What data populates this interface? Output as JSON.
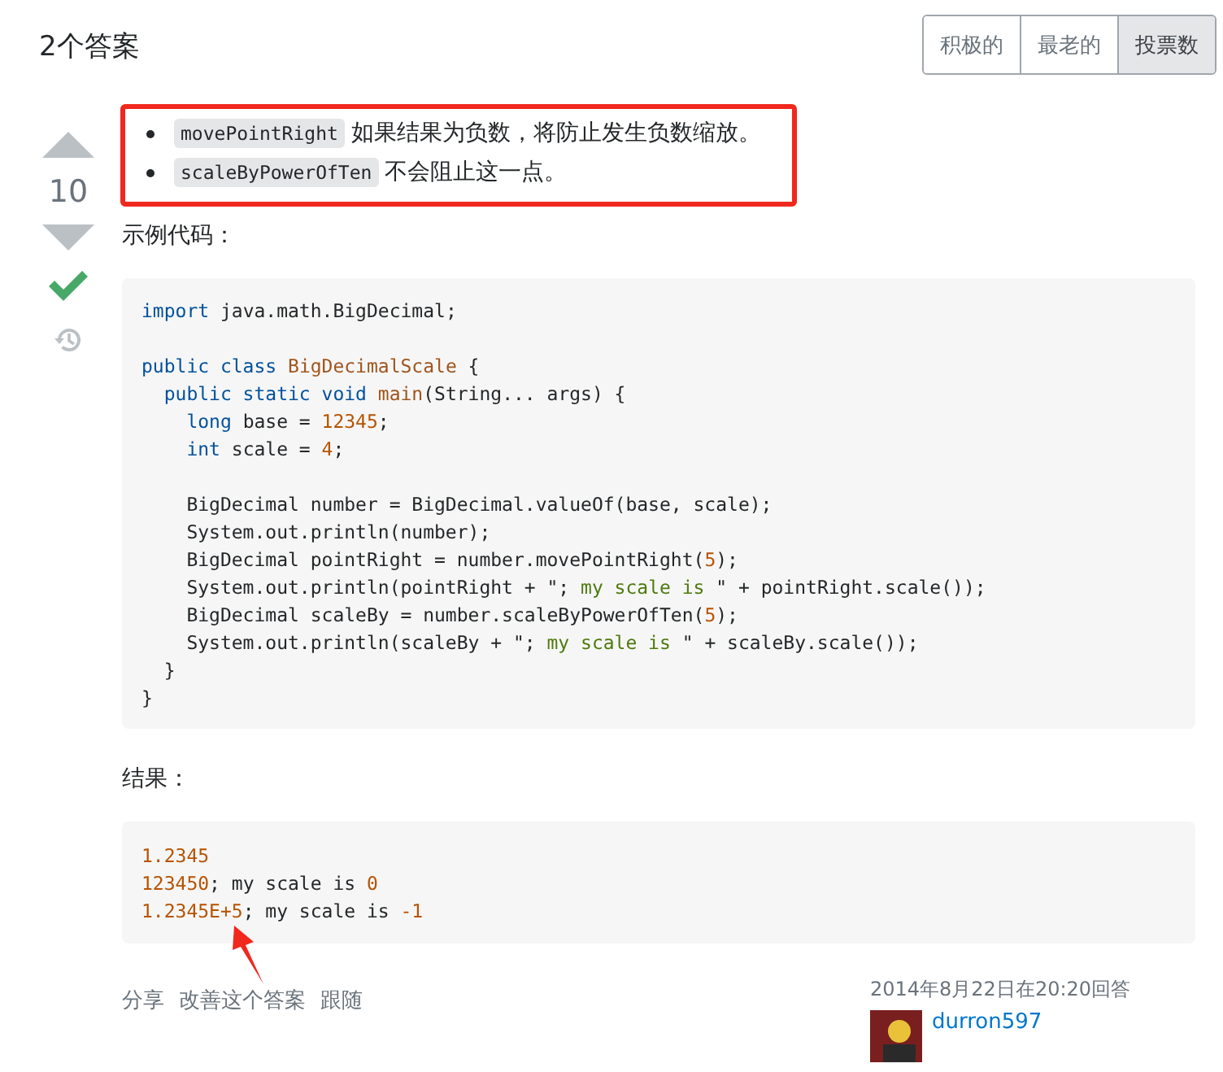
{
  "header": {
    "title": "2个答案"
  },
  "sort_tabs": [
    {
      "label": "积极的",
      "selected": false
    },
    {
      "label": "最老的",
      "selected": false
    },
    {
      "label": "投票数",
      "selected": true
    }
  ],
  "vote": {
    "score": "10",
    "accepted": true
  },
  "highlights": [
    {
      "code": "movePointRight",
      "text": "如果结果为负数，将防止发生负数缩放。"
    },
    {
      "code": "scaleByPowerOfTen",
      "text": "不会阻止这一点。"
    }
  ],
  "code_caption": "示例代码：",
  "code_lines": [
    {
      "kind": "code",
      "segments": [
        {
          "t": "import",
          "kind": "keyword"
        },
        {
          "t": " java.math.BigDecimal;",
          "kind": "plain"
        }
      ]
    },
    {
      "kind": "blank"
    },
    {
      "kind": "code",
      "segments": [
        {
          "t": "public class ",
          "kind": "keyword"
        },
        {
          "t": "BigDecimalScale",
          "kind": "title"
        },
        {
          "t": " {",
          "kind": "plain"
        }
      ]
    },
    {
      "kind": "code",
      "segments": [
        {
          "t": "  public static void ",
          "kind": "keyword"
        },
        {
          "t": "main",
          "kind": "title"
        },
        {
          "t": "(String... args) {",
          "kind": "plain"
        }
      ]
    },
    {
      "kind": "code",
      "segments": [
        {
          "t": "    long",
          "kind": "keyword"
        },
        {
          "t": " base = ",
          "kind": "plain"
        },
        {
          "t": "12345",
          "kind": "number"
        },
        {
          "t": ";",
          "kind": "plain"
        }
      ]
    },
    {
      "kind": "code",
      "segments": [
        {
          "t": "    int",
          "kind": "keyword"
        },
        {
          "t": " scale = ",
          "kind": "plain"
        },
        {
          "t": "4",
          "kind": "number"
        },
        {
          "t": ";",
          "kind": "plain"
        }
      ]
    },
    {
      "kind": "blank"
    },
    {
      "kind": "code",
      "segments": [
        {
          "t": "    BigDecimal number = BigDecimal.valueOf(base, scale);",
          "kind": "plain"
        }
      ]
    },
    {
      "kind": "code",
      "segments": [
        {
          "t": "    System.out.println(number);",
          "kind": "plain"
        }
      ]
    },
    {
      "kind": "code",
      "segments": [
        {
          "t": "    BigDecimal pointRight = number.movePointRight(",
          "kind": "plain"
        },
        {
          "t": "5",
          "kind": "number"
        },
        {
          "t": ");",
          "kind": "plain"
        }
      ]
    },
    {
      "kind": "code",
      "segments": [
        {
          "t": "    System.out.println(pointRight + \"; ",
          "kind": "plain"
        },
        {
          "t": "my scale is",
          "kind": "string"
        },
        {
          "t": " \" + pointRight.scale());",
          "kind": "plain"
        }
      ]
    },
    {
      "kind": "code",
      "segments": [
        {
          "t": "    BigDecimal scaleBy = number.scaleByPowerOfTen(",
          "kind": "plain"
        },
        {
          "t": "5",
          "kind": "number"
        },
        {
          "t": ");",
          "kind": "plain"
        }
      ]
    },
    {
      "kind": "code",
      "segments": [
        {
          "t": "    System.out.println(scaleBy + \"; ",
          "kind": "plain"
        },
        {
          "t": "my scale is",
          "kind": "string"
        },
        {
          "t": " \" + scaleBy.scale());",
          "kind": "plain"
        }
      ]
    },
    {
      "kind": "code",
      "segments": [
        {
          "t": "  }",
          "kind": "plain"
        }
      ]
    },
    {
      "kind": "code",
      "segments": [
        {
          "t": "}",
          "kind": "plain"
        }
      ]
    }
  ],
  "result_caption": "结果：",
  "output_lines": [
    {
      "kind": "code",
      "segments": [
        {
          "t": "1.2345",
          "kind": "number"
        }
      ]
    },
    {
      "kind": "code",
      "segments": [
        {
          "t": "123450",
          "kind": "number"
        },
        {
          "t": "; my scale is ",
          "kind": "plain"
        },
        {
          "t": "0",
          "kind": "number"
        }
      ]
    },
    {
      "kind": "code",
      "segments": [
        {
          "t": "1.2345E+5",
          "kind": "number"
        },
        {
          "t": "; my scale is ",
          "kind": "plain"
        },
        {
          "t": "-1",
          "kind": "number"
        }
      ]
    }
  ],
  "actions": [
    "分享",
    "改善这个答案",
    "跟随"
  ],
  "answered": {
    "time": "2014年8月22日在20:20回答",
    "user": "durron597"
  }
}
